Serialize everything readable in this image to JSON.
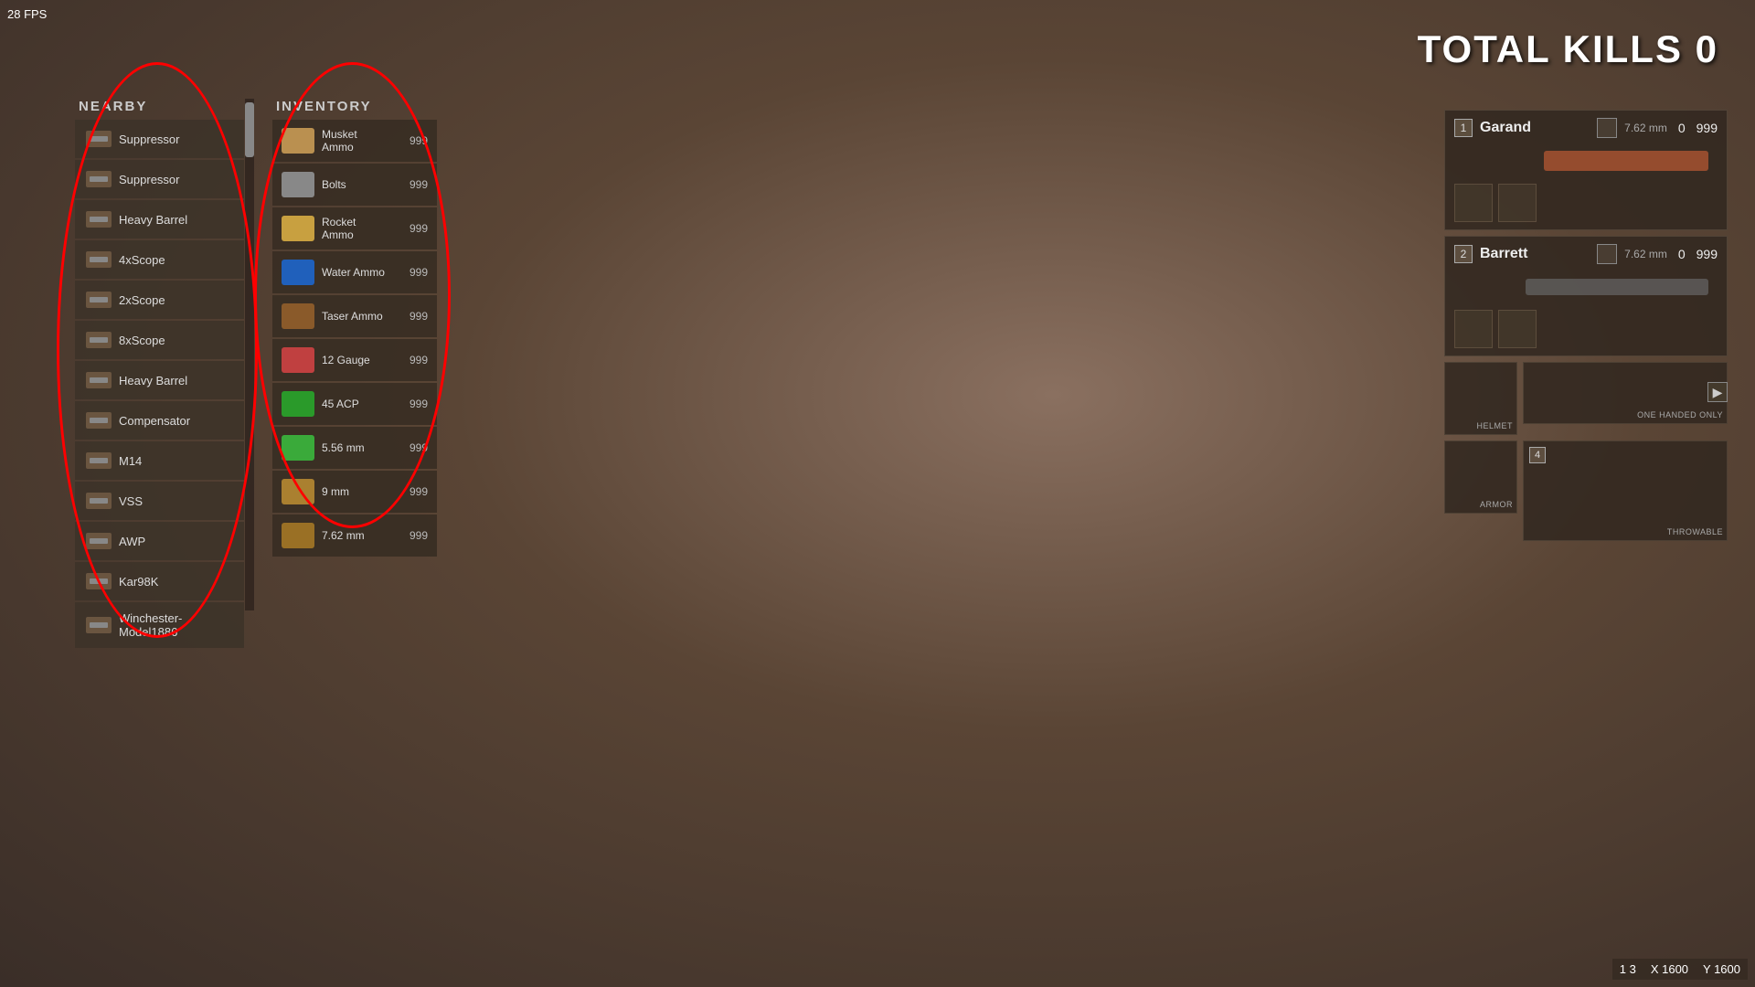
{
  "fps": "28 FPS",
  "total_kills_label": "TOTAL KILLS 0",
  "coords": {
    "x_label": "X 1600",
    "y_label": "Y 1600",
    "map_label": "1 3"
  },
  "nearby": {
    "title": "NEARBY",
    "items": [
      {
        "id": "suppressor1",
        "name": "Suppressor"
      },
      {
        "id": "suppressor2",
        "name": "Suppressor"
      },
      {
        "id": "heavy-barrel1",
        "name": "Heavy Barrel"
      },
      {
        "id": "4xscope",
        "name": "4xScope"
      },
      {
        "id": "2xscope",
        "name": "2xScope"
      },
      {
        "id": "8xscope",
        "name": "8xScope"
      },
      {
        "id": "heavy-barrel2",
        "name": "Heavy Barrel"
      },
      {
        "id": "compensator",
        "name": "Compensator"
      },
      {
        "id": "m14",
        "name": "M14"
      },
      {
        "id": "vss",
        "name": "VSS"
      },
      {
        "id": "awp",
        "name": "AWP"
      },
      {
        "id": "kar98k",
        "name": "Kar98K"
      },
      {
        "id": "winchester",
        "name": "Winchester-Model1886"
      }
    ]
  },
  "inventory": {
    "title": "INVENTORY",
    "items": [
      {
        "id": "musket-ammo",
        "name": "Musket\nAmmo",
        "count": "999",
        "color": "musket"
      },
      {
        "id": "bolts",
        "name": "Bolts",
        "count": "999",
        "color": "bolts"
      },
      {
        "id": "rocket-ammo",
        "name": "Rocket\nAmmo",
        "count": "999",
        "color": "ammo-rocket"
      },
      {
        "id": "water-ammo",
        "name": "Water Ammo",
        "count": "999",
        "color": "ammo-water"
      },
      {
        "id": "taser-ammo",
        "name": "Taser Ammo",
        "count": "999",
        "color": "ammo-taser"
      },
      {
        "id": "12-gauge",
        "name": "12 Gauge",
        "count": "999",
        "color": "ammo-12g"
      },
      {
        "id": "45-acp",
        "name": "45 ACP",
        "count": "999",
        "color": "ammo-45"
      },
      {
        "id": "556mm",
        "name": "5.56 mm",
        "count": "999",
        "color": "ammo-556"
      },
      {
        "id": "9mm",
        "name": "9 mm",
        "count": "999",
        "color": "ammo-9mm"
      },
      {
        "id": "762mm",
        "name": "7.62 mm",
        "count": "999",
        "color": "ammo-762"
      }
    ]
  },
  "weapons": [
    {
      "slot": "1",
      "name": "Garand",
      "ammo_type": "7.62 mm",
      "ammo_current": "0",
      "ammo_reserve": "999",
      "has_image": true,
      "color": "#a05030"
    },
    {
      "slot": "2",
      "name": "Barrett",
      "ammo_type": "7.62 mm",
      "ammo_current": "0",
      "ammo_reserve": "999",
      "has_image": true,
      "color": "#666"
    }
  ],
  "equipment": {
    "helmet_label": "HELMET",
    "one_handed_label": "ONE HANDED ONLY",
    "armor_label": "ARMOR",
    "throwable_slot": "4",
    "throwable_label": "THROWABLE"
  }
}
